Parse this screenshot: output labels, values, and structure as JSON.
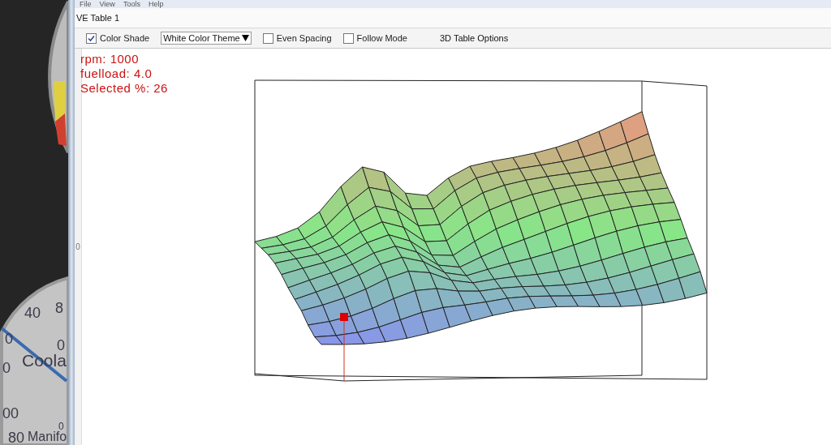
{
  "gauge_panel": {
    "labels": [
      "8",
      "40",
      "0",
      "0",
      "0",
      "Coola",
      "00",
      "0",
      "80",
      "Manifo"
    ]
  },
  "menu": [
    {
      "label": "File"
    },
    {
      "label": "View"
    },
    {
      "label": "Tools"
    },
    {
      "label": "Help"
    }
  ],
  "window": {
    "title": "VE Table 1"
  },
  "toolbar": [
    {
      "kind": "checkbox",
      "label": "Color Shade",
      "checked": true
    },
    {
      "kind": "dropdown",
      "value": "White Color Theme"
    },
    {
      "kind": "checkbox",
      "label": "Even Spacing",
      "checked": false
    },
    {
      "kind": "checkbox",
      "label": "Follow Mode",
      "checked": false
    },
    {
      "kind": "button",
      "label": "3D Table Options"
    }
  ],
  "axis_label": "0",
  "readout": [
    "rpm: 1000",
    "fuelload: 4.0",
    "Selected %: 26"
  ]
}
